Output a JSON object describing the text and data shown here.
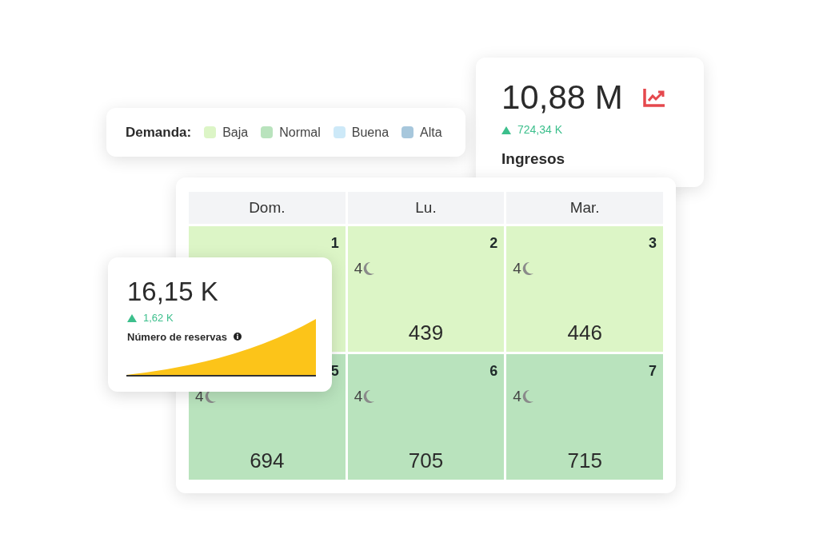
{
  "legend": {
    "title": "Demanda:",
    "items": [
      {
        "label": "Baja",
        "color": "#dcf5c6"
      },
      {
        "label": "Normal",
        "color": "#b9e3bd"
      },
      {
        "label": "Buena",
        "color": "#cde9f8"
      },
      {
        "label": "Alta",
        "color": "#a7c7dc"
      }
    ]
  },
  "revenue": {
    "value": "10,88 M",
    "delta": "724,34 K",
    "label": "Ingresos"
  },
  "calendar": {
    "columns": [
      "Dom.",
      "Lu.",
      "Mar."
    ],
    "cells": [
      {
        "day": "1",
        "color": "#dcf5c6"
      },
      {
        "day": "2",
        "nights": "4",
        "count": "439",
        "color": "#dcf5c6"
      },
      {
        "day": "3",
        "nights": "4",
        "count": "446",
        "color": "#dcf5c6"
      },
      {
        "day": "5",
        "nights": "4",
        "count": "694",
        "color": "#b9e3bd"
      },
      {
        "day": "6",
        "nights": "4",
        "count": "705",
        "color": "#b9e3bd"
      },
      {
        "day": "7",
        "nights": "4",
        "count": "715",
        "color": "#b9e3bd"
      }
    ]
  },
  "bookings": {
    "value": "16,15 K",
    "delta": "1,62 K",
    "label": "Número de reservas"
  }
}
